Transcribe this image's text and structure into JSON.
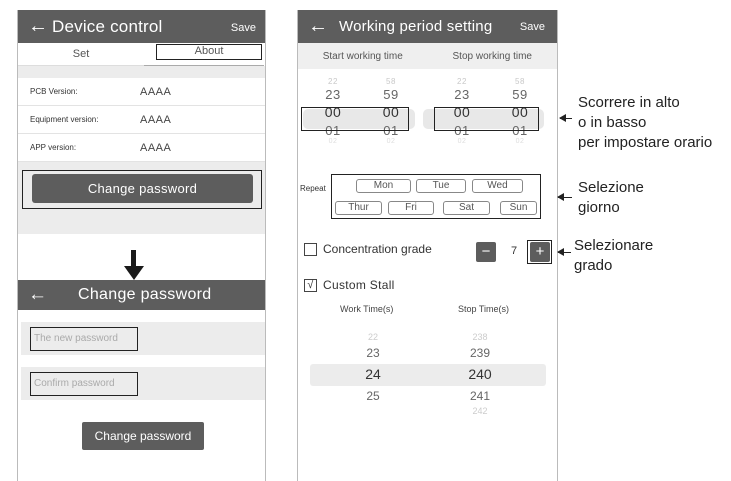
{
  "left_screen": {
    "header": {
      "back_icon": "arrow-left",
      "title": "Device control",
      "save_label": "Save"
    },
    "tabs": {
      "set": "Set",
      "about": "About"
    },
    "info_rows": [
      {
        "label": "PCB Version:",
        "value": "AAAA"
      },
      {
        "label": "Equipment version:",
        "value": "AAAA"
      },
      {
        "label": "APP version:",
        "value": "AAAA"
      }
    ],
    "change_password_button": "Change password"
  },
  "change_password_screen": {
    "header": {
      "back_icon": "arrow-left",
      "title": "Change password"
    },
    "new_password_placeholder": "The new password",
    "confirm_password_placeholder": "Confirm password",
    "submit_button": "Change password"
  },
  "right_screen": {
    "header": {
      "back_icon": "arrow-left",
      "title": "Working period setting",
      "save_label": "Save"
    },
    "start_label": "Start working time",
    "stop_label": "Stop working time",
    "start_wheel": {
      "hours": [
        "22",
        "23",
        "00",
        "01",
        "02"
      ],
      "minutes": [
        "58",
        "59",
        "00",
        "01",
        "02"
      ]
    },
    "stop_wheel": {
      "hours": [
        "22",
        "23",
        "00",
        "01",
        "02"
      ],
      "minutes": [
        "58",
        "59",
        "00",
        "01",
        "02"
      ]
    },
    "repeat_label": "Repeat",
    "days_row1": [
      "Mon",
      "Tue",
      "Wed"
    ],
    "days_row2": [
      "Thur",
      "Fri",
      "Sat",
      "Sun"
    ],
    "concentration": {
      "label": "Concentration grade",
      "value": "7",
      "minus": "−",
      "plus": "+",
      "checked": false
    },
    "custom_stall": {
      "label": "Custom Stall",
      "check_mark": "√",
      "checked": true
    },
    "work_time_label": "Work Time(s)",
    "stop_time_label": "Stop Time(s)",
    "work_wheel": [
      "22",
      "23",
      "24",
      "25"
    ],
    "stop_wheel_values": [
      "238",
      "239",
      "240",
      "241",
      "242"
    ]
  },
  "annotations": {
    "scroll": [
      "Scorrere in alto",
      "o in basso",
      "per impostare orario"
    ],
    "day": [
      "Selezione",
      "giorno"
    ],
    "grade": [
      "Selezionare",
      "grado"
    ]
  }
}
